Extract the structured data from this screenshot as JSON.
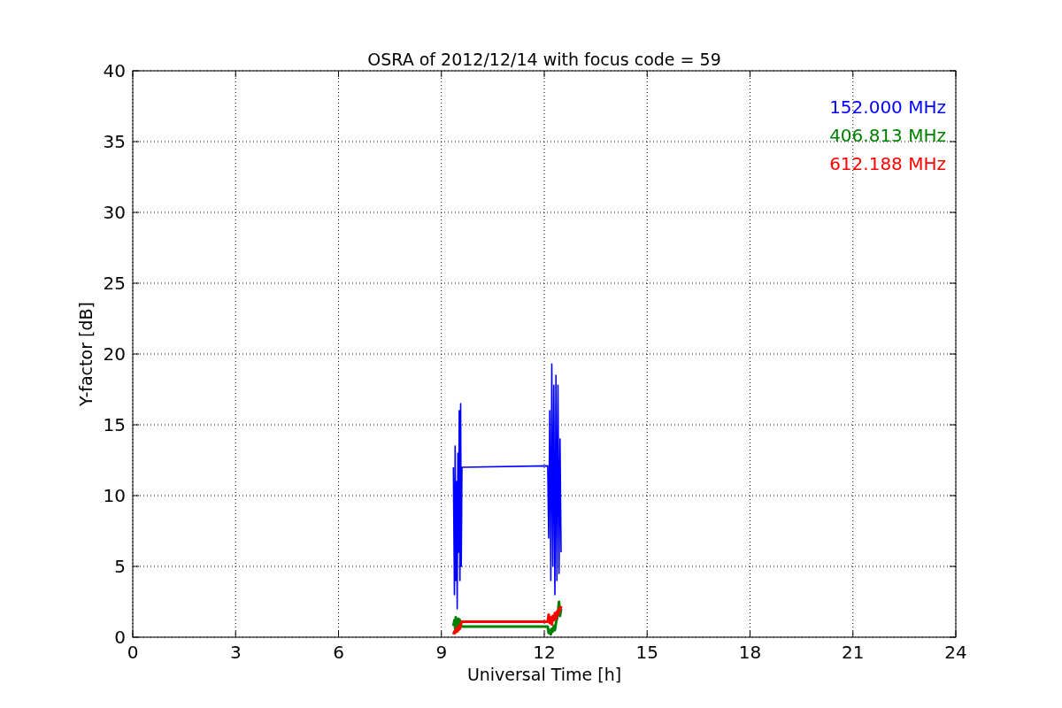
{
  "chart_data": {
    "type": "line",
    "title": "OSRA of 2012/12/14 with focus code = 59",
    "xlabel": "Universal Time [h]",
    "ylabel": "Y-factor [dB]",
    "x": [
      9.35,
      9.38,
      9.4,
      9.42,
      9.44,
      9.46,
      9.48,
      9.5,
      9.52,
      9.54,
      9.56,
      9.58,
      9.6,
      12.1,
      12.13,
      12.16,
      12.19,
      12.22,
      12.25,
      12.28,
      12.31,
      12.34,
      12.37,
      12.4,
      12.43,
      12.46,
      12.49
    ],
    "series": [
      {
        "name": "152.000 MHz",
        "color": "#0000ff",
        "values": [
          12,
          3,
          13.5,
          4,
          11,
          2,
          13,
          6,
          16,
          4,
          16.5,
          5,
          12,
          12.1,
          7,
          16,
          4,
          19.3,
          5,
          17.8,
          3,
          18.5,
          4,
          17.8,
          4.5,
          14,
          6
        ]
      },
      {
        "name": "406.813 MHz",
        "color": "#008000",
        "values": [
          0.8,
          1.2,
          0.6,
          1.4,
          0.9,
          1.1,
          0.7,
          1.3,
          0.9,
          1.2,
          1.0,
          0.8,
          0.75,
          0.75,
          0.3,
          0.5,
          0.2,
          0.6,
          0.4,
          0.8,
          0.5,
          1.0,
          1.3,
          1.8,
          2.5,
          1.5,
          2.0
        ]
      },
      {
        "name": "612.188 MHz",
        "color": "#ff0000",
        "values": [
          0.2,
          0.4,
          0.3,
          0.5,
          0.6,
          0.4,
          0.7,
          0.5,
          0.8,
          0.6,
          0.9,
          1.0,
          1.1,
          1.1,
          1.6,
          1.0,
          1.4,
          0.9,
          1.5,
          1.2,
          1.7,
          1.3,
          1.8,
          1.6,
          2.0,
          1.9,
          2.2
        ]
      }
    ],
    "grid": true,
    "xlim": [
      0,
      24
    ],
    "ylim": [
      0,
      40
    ],
    "xticks": [
      0,
      3,
      6,
      9,
      12,
      15,
      18,
      21,
      24
    ],
    "yticks": [
      0,
      5,
      10,
      15,
      20,
      25,
      30,
      35,
      40
    ]
  }
}
